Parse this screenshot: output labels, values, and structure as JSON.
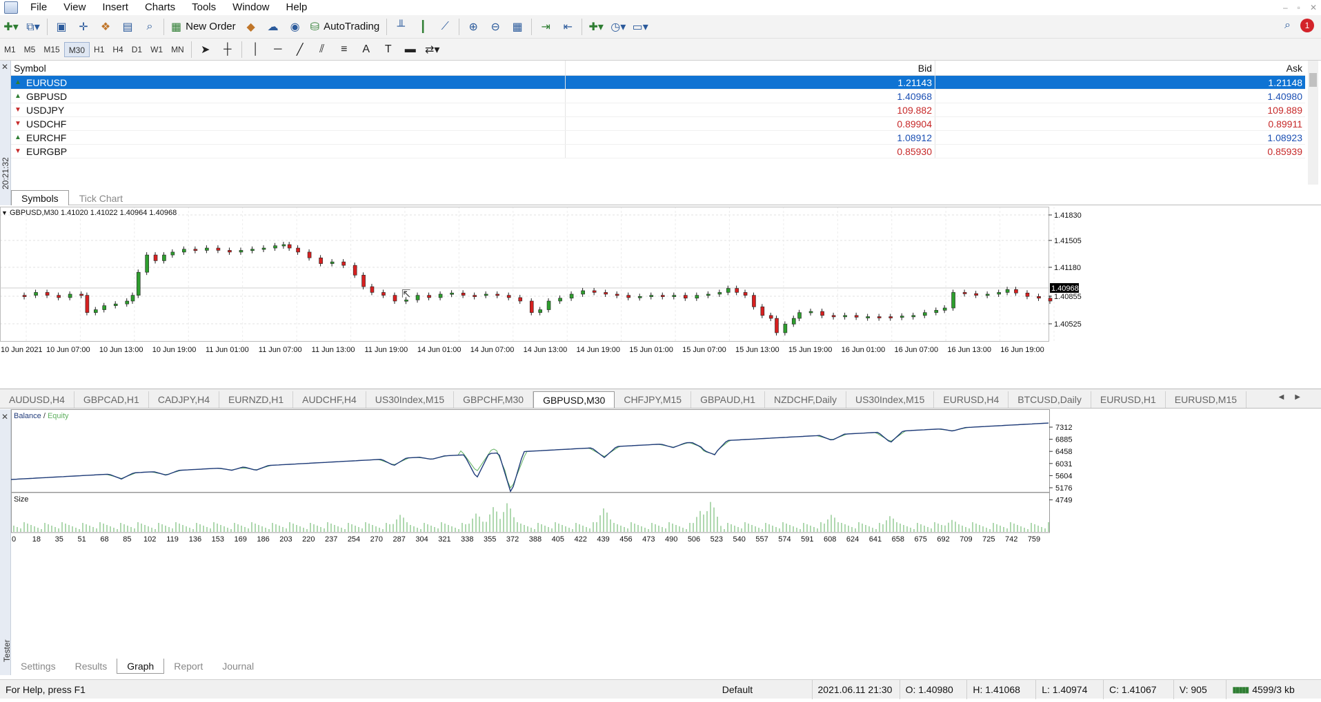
{
  "menu": {
    "items": [
      "File",
      "View",
      "Insert",
      "Charts",
      "Tools",
      "Window",
      "Help"
    ]
  },
  "toolbar": {
    "new_order_label": "New Order",
    "autotrading_label": "AutoTrading",
    "notification_count": "1",
    "timeframes": [
      "M1",
      "M5",
      "M15",
      "M30",
      "H1",
      "H4",
      "D1",
      "W1",
      "MN"
    ],
    "active_timeframe": "M30"
  },
  "market_watch": {
    "time": "20:21:32",
    "columns": {
      "symbol": "Symbol",
      "bid": "Bid",
      "ask": "Ask"
    },
    "rows": [
      {
        "symbol": "EURUSD",
        "bid": "1.21143",
        "ask": "1.21148",
        "direction": "up",
        "selected": true
      },
      {
        "symbol": "GBPUSD",
        "bid": "1.40968",
        "ask": "1.40980",
        "direction": "up",
        "selected": false
      },
      {
        "symbol": "USDJPY",
        "bid": "109.882",
        "ask": "109.889",
        "direction": "down",
        "selected": false
      },
      {
        "symbol": "USDCHF",
        "bid": "0.89904",
        "ask": "0.89911",
        "direction": "down",
        "selected": false
      },
      {
        "symbol": "EURCHF",
        "bid": "1.08912",
        "ask": "1.08923",
        "direction": "up",
        "selected": false
      },
      {
        "symbol": "EURGBP",
        "bid": "0.85930",
        "ask": "0.85939",
        "direction": "down",
        "selected": false
      }
    ],
    "tabs": [
      "Symbols",
      "Tick Chart"
    ],
    "active_tab": "Symbols"
  },
  "chart": {
    "header": "GBPUSD,M30  1.41020 1.41022 1.40964 1.40968",
    "price_labels": [
      "1.41830",
      "1.41505",
      "1.41180",
      "1.40855",
      "1.40525"
    ],
    "current_price": "1.40968",
    "time_labels": [
      "10 Jun 2021",
      "10 Jun 07:00",
      "10 Jun 13:00",
      "10 Jun 19:00",
      "11 Jun 01:00",
      "11 Jun 07:00",
      "11 Jun 13:00",
      "11 Jun 19:00",
      "14 Jun 01:00",
      "14 Jun 07:00",
      "14 Jun 13:00",
      "14 Jun 19:00",
      "15 Jun 01:00",
      "15 Jun 07:00",
      "15 Jun 13:00",
      "15 Jun 19:00",
      "16 Jun 01:00",
      "16 Jun 07:00",
      "16 Jun 13:00",
      "16 Jun 19:00"
    ],
    "bull_color": "#2e9e2e",
    "bear_color": "#d62020"
  },
  "chart_tabs": {
    "items": [
      "AUDUSD,H4",
      "GBPCAD,H1",
      "CADJPY,H4",
      "EURNZD,H1",
      "AUDCHF,H4",
      "US30Index,M15",
      "GBPCHF,M30",
      "GBPUSD,M30",
      "CHFJPY,M15",
      "GBPAUD,H1",
      "NZDCHF,Daily",
      "US30Index,M15",
      "EURUSD,H4",
      "BTCUSD,Daily",
      "EURUSD,H1",
      "EURUSD,M15"
    ],
    "active": "GBPUSD,M30"
  },
  "tester": {
    "side_label": "Tester",
    "legend_balance": "Balance",
    "legend_sep": " / ",
    "legend_equity": "Equity",
    "balance_color": "#1f3a7a",
    "equity_color": "#5fb05f",
    "size_label": "Size",
    "y_labels": [
      "7312",
      "6885",
      "6458",
      "6031",
      "5604",
      "5176",
      "4749"
    ],
    "x_labels": [
      "0",
      "18",
      "35",
      "51",
      "68",
      "85",
      "102",
      "119",
      "136",
      "153",
      "169",
      "186",
      "203",
      "220",
      "237",
      "254",
      "270",
      "287",
      "304",
      "321",
      "338",
      "355",
      "372",
      "388",
      "405",
      "422",
      "439",
      "456",
      "473",
      "490",
      "506",
      "523",
      "540",
      "557",
      "574",
      "591",
      "608",
      "624",
      "641",
      "658",
      "675",
      "692",
      "709",
      "725",
      "742",
      "759"
    ],
    "tabs": [
      "Settings",
      "Results",
      "Graph",
      "Report",
      "Journal"
    ],
    "active_tab": "Graph"
  },
  "statusbar": {
    "help": "For Help, press F1",
    "profile": "Default",
    "datetime": "2021.06.11 21:30",
    "open": "O: 1.40980",
    "high": "H: 1.41068",
    "low": "L: 1.40974",
    "close": "C: 1.41067",
    "volume": "V: 905",
    "traffic": "4599/3 kb"
  }
}
